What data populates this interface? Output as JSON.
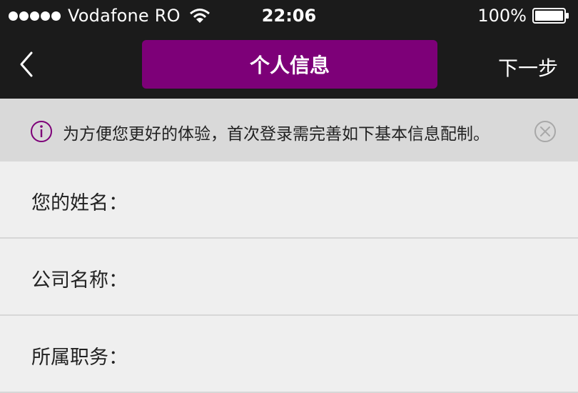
{
  "status_bar": {
    "carrier": "Vodafone RO",
    "time": "22:06",
    "battery": "100%",
    "signal_icon": "signal-dots-icon",
    "wifi_icon": "wifi-icon",
    "battery_icon": "battery-icon"
  },
  "nav": {
    "back_icon": "chevron-left-icon",
    "title": "个人信息",
    "next_label": "下一步"
  },
  "notice": {
    "icon": "info-icon",
    "text": "为方便您更好的体验，首次登录需完善如下基本信息配制。",
    "close_icon": "close-icon"
  },
  "form": {
    "fields": [
      {
        "label": "您的姓名：",
        "value": ""
      },
      {
        "label": "公司名称：",
        "value": ""
      },
      {
        "label": "所属职务：",
        "value": ""
      }
    ]
  },
  "colors": {
    "accent": "#7d0078",
    "nav_background": "#1b1b1b",
    "notice_background": "#d9d9d9",
    "form_background": "#efefef"
  }
}
